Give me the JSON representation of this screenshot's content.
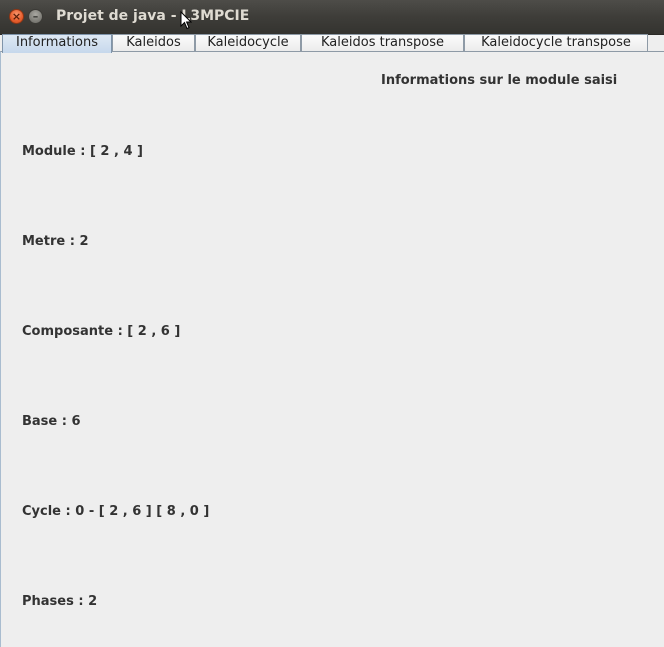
{
  "window": {
    "title": "Projet de java - L3MPCIE",
    "close_glyph": "×",
    "minimize_glyph": "–"
  },
  "tabs": [
    {
      "label": "Informations",
      "selected": true
    },
    {
      "label": "Kaleidos",
      "selected": false
    },
    {
      "label": "Kaleidocycle",
      "selected": false
    },
    {
      "label": "Kaleidos transpose",
      "selected": false
    },
    {
      "label": "Kaleidocycle transpose",
      "selected": false
    }
  ],
  "panel": {
    "heading": "Informations sur le module saisi",
    "fields": {
      "module": "Module : [ 2 , 4 ]",
      "metre": "Metre : 2",
      "composante": "Composante : [ 2 , 6 ]",
      "base": "Base : 6",
      "cycle": "Cycle : 0 - [ 2 , 6 ] [ 8 , 0 ]",
      "phases": "Phases : 2"
    }
  },
  "colors": {
    "titlebar": "#3f3e3a",
    "close_button": "#e9602f",
    "selected_tab": "#c6d8ec",
    "background": "#eeeeee"
  }
}
